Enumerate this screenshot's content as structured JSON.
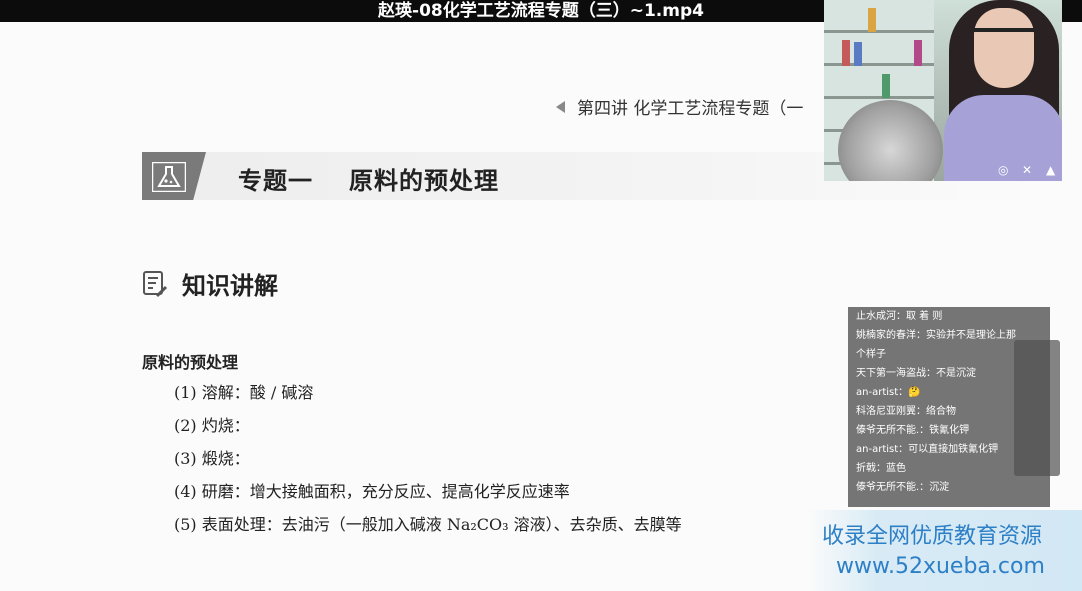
{
  "window": {
    "title": "赵瑛-08化学工艺流程专题（三）~1.mp4"
  },
  "lecture_header": "第四讲  化学工艺流程专题（一",
  "topic_banner": {
    "part": "专题一",
    "name": "原料的预处理"
  },
  "section": {
    "label": "知识讲解"
  },
  "sub_heading": "原料的预处理",
  "items": [
    "(1) 溶解：酸 / 碱溶",
    "(2) 灼烧：",
    "(3) 煅烧：",
    "(4) 研磨：增大接触面积，充分反应、提高化学反应速率",
    "(5) 表面处理：去油污（一般加入碱液 Na₂CO₃ 溶液）、去杂质、去膜等"
  ],
  "chat": [
    "止水成河：取 着 则",
    "姚楠家的春洋：实验并不是理论上那",
    "个样子",
    "天下第一海盗战：不是沉淀",
    "an-artist：🤔",
    "科洛尼亚刚翼：络合物",
    "傣爷无所不能.：铁氰化钾",
    "an-artist：可以直接加铁氰化钾",
    "折戟：蓝色",
    "傣爷无所不能.：沉淀",
    "…"
  ],
  "watermark": {
    "line1": "收录全网优质教育资源",
    "line2": "www.52xueba.com"
  },
  "colors": {
    "title_bar": "#0c0c0c",
    "banner_icon": "#7a7a7a",
    "watermark_text": "#2d7fc6"
  }
}
